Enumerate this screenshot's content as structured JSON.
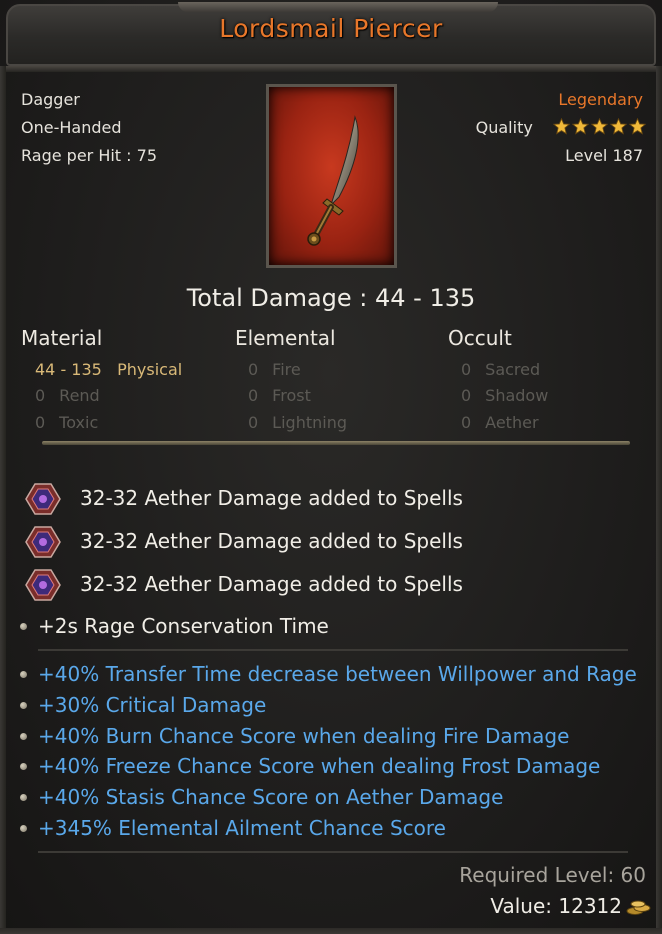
{
  "item": {
    "name": "Lordsmail Piercer",
    "type": "Dagger",
    "handedness": "One-Handed",
    "rage_label": "Rage per Hit : 75",
    "rarity": "Legendary",
    "quality_label": "Quality",
    "quality_stars": 5,
    "level_label": "Level 187",
    "icon": "curved-dagger-icon"
  },
  "damage": {
    "total_label": "Total Damage : 44 - 135",
    "columns": [
      {
        "header": "Material",
        "rows": [
          {
            "value": "44 - 135",
            "type": "Physical"
          },
          {
            "value": "0",
            "type": "Rend"
          },
          {
            "value": "0",
            "type": "Toxic"
          }
        ]
      },
      {
        "header": "Elemental",
        "rows": [
          {
            "value": "0",
            "type": "Fire"
          },
          {
            "value": "0",
            "type": "Frost"
          },
          {
            "value": "0",
            "type": "Lightning"
          }
        ]
      },
      {
        "header": "Occult",
        "rows": [
          {
            "value": "0",
            "type": "Sacred"
          },
          {
            "value": "0",
            "type": "Shadow"
          },
          {
            "value": "0",
            "type": "Aether"
          }
        ]
      }
    ]
  },
  "socket_mods": [
    "32-32 Aether Damage added to Spells",
    "32-32 Aether Damage added to Spells",
    "32-32 Aether Damage added to Spells"
  ],
  "base_mods": [
    "+2s Rage Conservation Time"
  ],
  "magic_mods": [
    "+40% Transfer Time decrease between Willpower and Rage",
    "+30% Critical Damage",
    "+40% Burn Chance Score when dealing Fire Damage",
    "+40% Freeze Chance Score when dealing Frost Damage",
    "+40% Stasis Chance Score on Aether Damage",
    "+345% Elemental Ailment Chance Score"
  ],
  "footer": {
    "required_level": "Required Level: 60",
    "value": "Value: 12312"
  },
  "colors": {
    "legendary": "#e8772a",
    "magic_mod": "#5aa8ea",
    "physical": "#d9b978",
    "disabled": "#5c5a55"
  }
}
